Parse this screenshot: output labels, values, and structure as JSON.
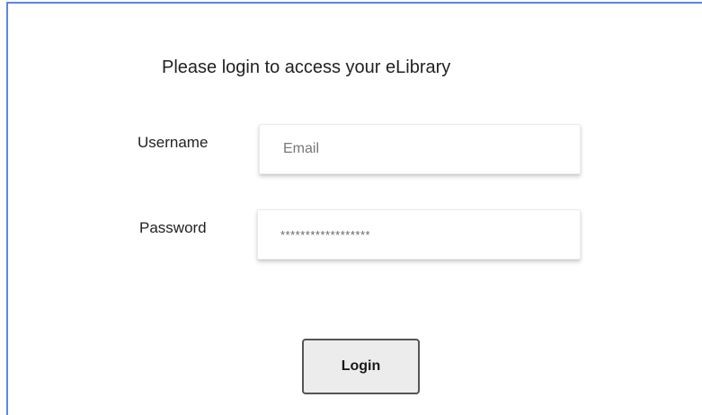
{
  "login_panel": {
    "heading": "Please login to access your eLibrary",
    "username": {
      "label": "Username",
      "placeholder": "Email"
    },
    "password": {
      "label": "Password",
      "masked_value": "******************"
    },
    "login_button": "Login"
  },
  "colors": {
    "frame_border": "#5b86e5",
    "button_background": "#ececec"
  }
}
